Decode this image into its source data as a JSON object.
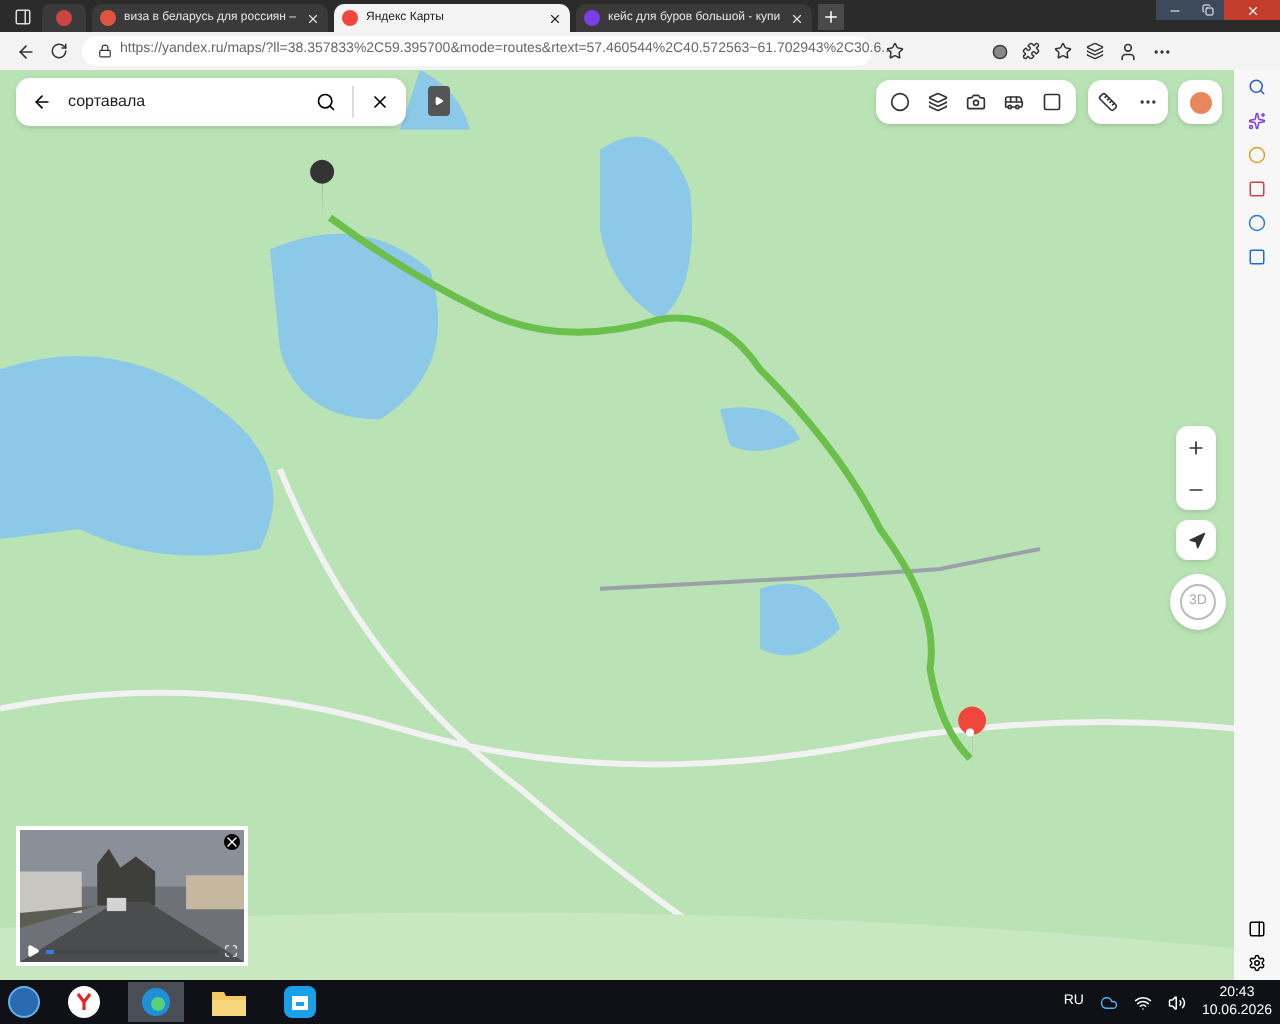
{
  "browser": {
    "tabs": [
      {
        "title": "виза в беларусь для россиян –",
        "selected": false,
        "color": "#e0533d"
      },
      {
        "title": "Яндекс Карты",
        "selected": true,
        "color": "#f0463c"
      },
      {
        "title": "кейс для буров большой - купи",
        "selected": false,
        "color": "#7b3fe4"
      }
    ],
    "url": "https://yandex.ru/maps/?ll=38.357833%2C59.395700&mode=routes&rtext=57.460544%2C40.572563~61.702943%2C30.6..."
  },
  "map": {
    "search": {
      "value": "сортавала"
    },
    "compass_label": "3D",
    "video": {
      "level": 0.05
    }
  },
  "taskbar": {
    "apps": [
      {
        "kind": "yandex",
        "selected": false
      },
      {
        "kind": "edge",
        "selected": true
      },
      {
        "kind": "folder",
        "selected": false
      },
      {
        "kind": "store",
        "selected": false
      }
    ],
    "language": "RU",
    "time": "20:43",
    "date": "10.06.2026"
  }
}
